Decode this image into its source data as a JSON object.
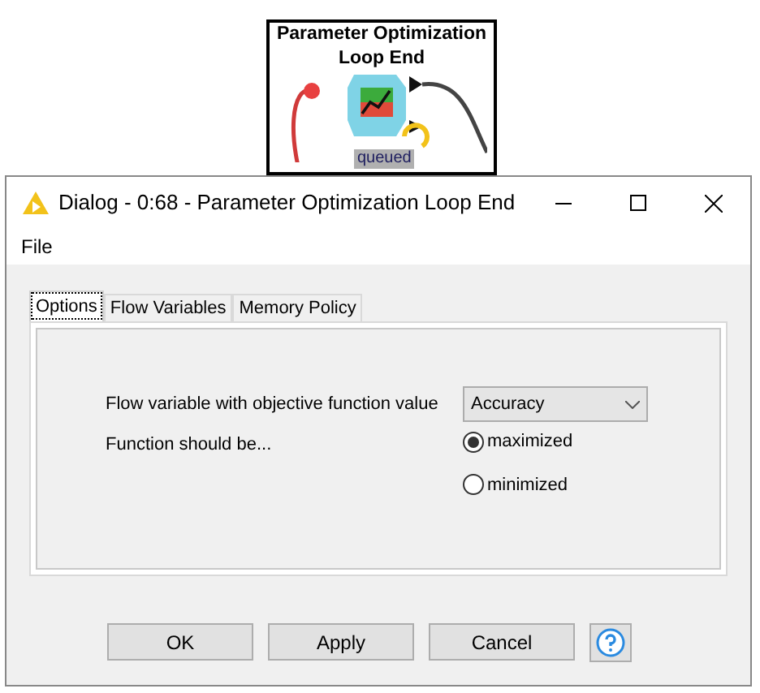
{
  "node": {
    "title": "Parameter Optimization Loop End",
    "status": "queued"
  },
  "window": {
    "title": "Dialog - 0:68 - Parameter Optimization Loop End"
  },
  "menu": [
    "File"
  ],
  "tabs": [
    {
      "label": "Options",
      "selected": true
    },
    {
      "label": "Flow Variables",
      "selected": false
    },
    {
      "label": "Memory Policy",
      "selected": false
    }
  ],
  "objective": {
    "label": "Flow variable with objective function value",
    "value": "Accuracy"
  },
  "direction": {
    "label": "Function should be...",
    "options": [
      {
        "label": "maximized",
        "selected": true
      },
      {
        "label": "minimized",
        "selected": false
      }
    ]
  },
  "buttons": [
    {
      "label": "OK",
      "kind": "text"
    },
    {
      "label": "Apply",
      "kind": "text"
    },
    {
      "label": "Cancel",
      "kind": "text"
    },
    {
      "kind": "help"
    }
  ]
}
